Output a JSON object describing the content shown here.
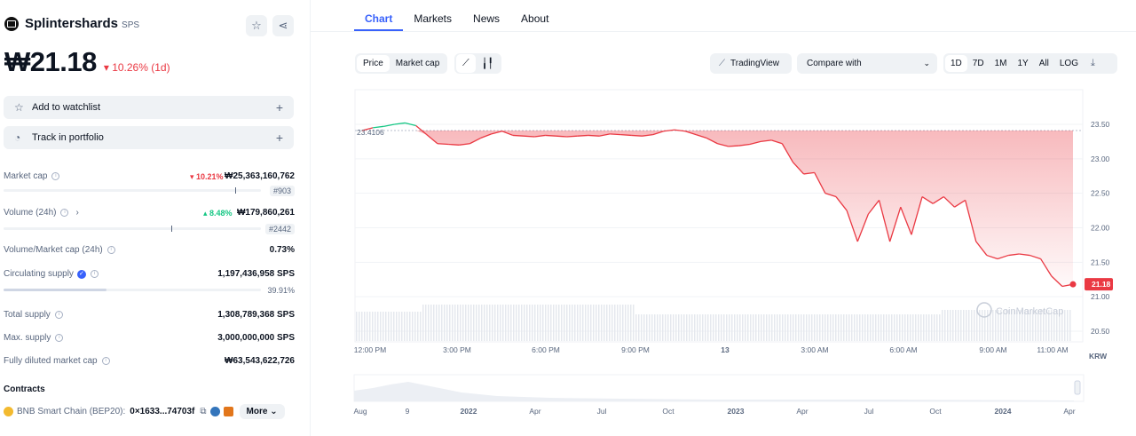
{
  "coin": {
    "name": "Splintershards",
    "symbol": "SPS",
    "price": "₩21.18",
    "price_change": "▾ 10.26% (1d)"
  },
  "actions": {
    "watchlist": "Add to watchlist",
    "portfolio": "Track in portfolio"
  },
  "stats": {
    "market_cap": {
      "label": "Market cap",
      "change": "▾ 10.21%",
      "value": "₩25,363,160,762",
      "rank": "#903",
      "level": 0.9
    },
    "volume": {
      "label": "Volume (24h)",
      "change": "▴ 8.48%",
      "value": "₩179,860,261",
      "rank": "#2442",
      "level": 0.65
    },
    "vol_mcap": {
      "label": "Volume/Market cap (24h)",
      "value": "0.73%"
    },
    "circulating": {
      "label": "Circulating supply",
      "value": "1,197,436,958 SPS",
      "percent": "39.91%",
      "fraction": 0.3991
    },
    "total_supply": {
      "label": "Total supply",
      "value": "1,308,789,368 SPS"
    },
    "max_supply": {
      "label": "Max. supply",
      "value": "3,000,000,000 SPS"
    },
    "fdmc": {
      "label": "Fully diluted market cap",
      "value": "₩63,543,622,726"
    }
  },
  "contracts": {
    "title": "Contracts",
    "chain": "BNB Smart Chain (BEP20):",
    "address": "0×1633...74703f",
    "more": "More"
  },
  "tabs": [
    "Chart",
    "Markets",
    "News",
    "About"
  ],
  "controls": {
    "price": "Price",
    "market_cap": "Market cap",
    "line_icon": "line-chart-icon",
    "candle_icon": "candlestick-icon",
    "tradingview": "TradingView",
    "compare": "Compare with",
    "ranges": [
      "1D",
      "7D",
      "1M",
      "1Y",
      "All",
      "LOG"
    ]
  },
  "colors": {
    "up": "#16c784",
    "down": "#ea3943",
    "accent": "#3861fb"
  },
  "chart_data": {
    "type": "line",
    "currency": "KRW",
    "open_reference": "23.4106",
    "last_price_label": "21.18",
    "watermark": "CoinMarketCap",
    "y_ticks": [
      "23.50",
      "23.00",
      "22.50",
      "22.00",
      "21.50",
      "21.00",
      "20.50"
    ],
    "ylim": [
      20.5,
      23.5
    ],
    "x_ticks": [
      "12:00 PM",
      "3:00 PM",
      "6:00 PM",
      "9:00 PM",
      "13",
      "3:00 AM",
      "6:00 AM",
      "9:00 AM",
      "11:00 AM"
    ],
    "series": [
      {
        "values": [
          23.41,
          23.45,
          23.47,
          23.5,
          23.52,
          23.48,
          23.35,
          23.22,
          23.21,
          23.2,
          23.22,
          23.3,
          23.36,
          23.4,
          23.34,
          23.33,
          23.32,
          23.34,
          23.33,
          23.32,
          23.33,
          23.34,
          23.33,
          23.36,
          23.35,
          23.34,
          23.33,
          23.35,
          23.4,
          23.42,
          23.4,
          23.35,
          23.3,
          23.22,
          23.18,
          23.19,
          23.21,
          23.25,
          23.27,
          23.22,
          22.95,
          22.78,
          22.8,
          22.5,
          22.45,
          22.25,
          21.8,
          22.2,
          22.4,
          21.8,
          22.3,
          21.9,
          22.45,
          22.35,
          22.45,
          22.3,
          22.4,
          21.8,
          21.6,
          21.55,
          21.6,
          21.62,
          21.6,
          21.55,
          21.3,
          21.15,
          21.18
        ]
      }
    ],
    "navigator_ticks": [
      "Aug",
      "9",
      "2022",
      "Apr",
      "Jul",
      "Oct",
      "2023",
      "Apr",
      "Jul",
      "Oct",
      "2024",
      "Apr"
    ]
  }
}
